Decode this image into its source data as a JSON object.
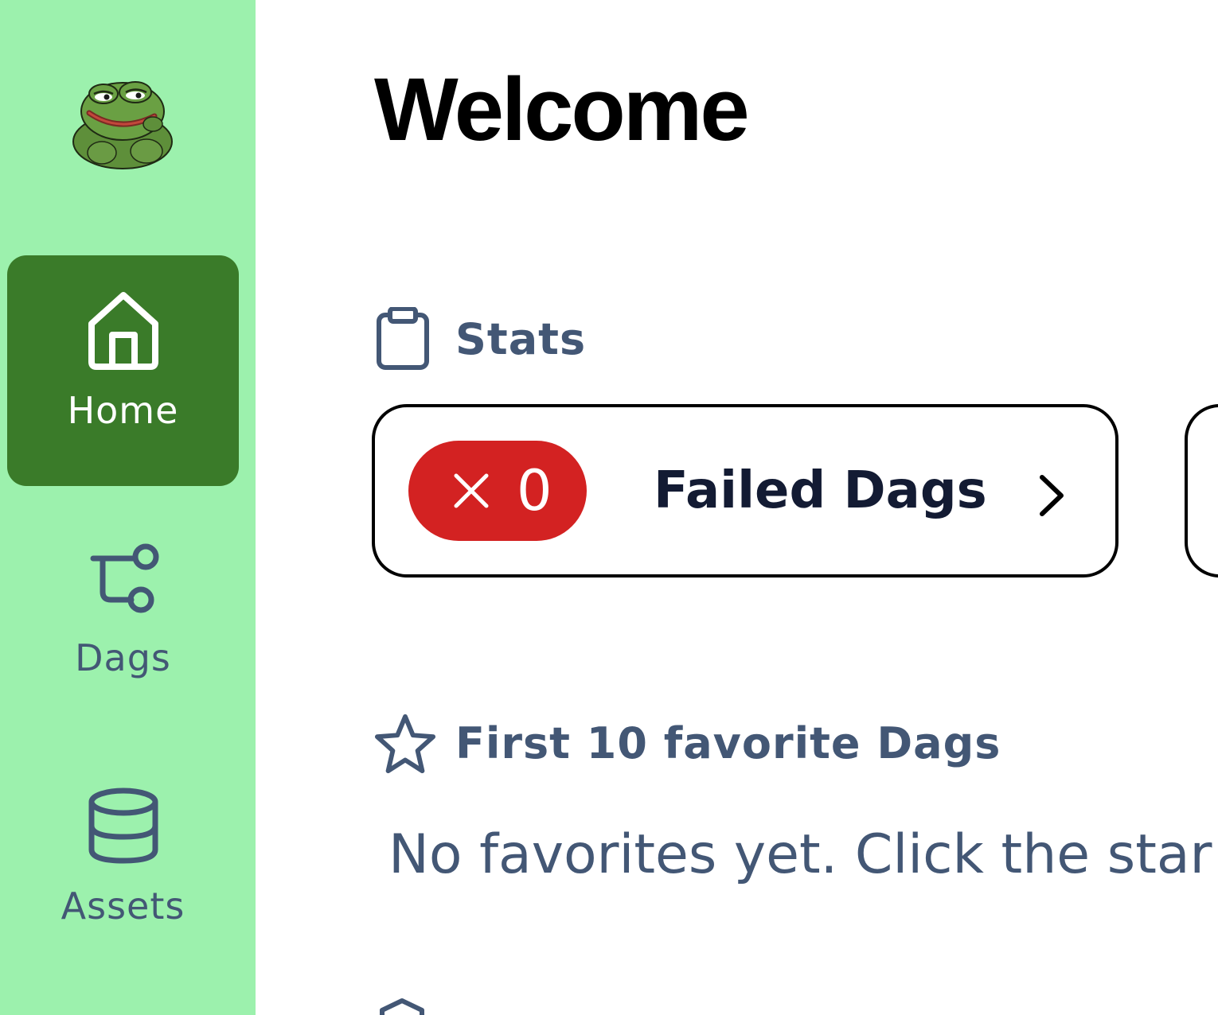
{
  "sidebar": {
    "logo": "frog-logo",
    "items": [
      {
        "label": "Home",
        "icon": "home-icon",
        "active": true
      },
      {
        "label": "Dags",
        "icon": "git-branch-icon",
        "active": false
      },
      {
        "label": "Assets",
        "icon": "database-icon",
        "active": false
      }
    ]
  },
  "main": {
    "title": "Welcome",
    "stats": {
      "heading": "Stats",
      "icon": "clipboard-icon",
      "cards": [
        {
          "count": "0",
          "label": "Failed Dags",
          "badge_color": "#d32222",
          "badge_icon": "x-icon",
          "chevron": "chevron-right-icon"
        }
      ]
    },
    "favorites": {
      "heading": "First 10 favorite Dags",
      "icon": "star-icon",
      "empty_text": "No favorites yet. Click the star i"
    },
    "health": {
      "icon": "shield-icon"
    }
  },
  "colors": {
    "sidebar_bg": "#9cf1ad",
    "active_nav": "#3a7b29",
    "muted_text": "#435775",
    "danger": "#d32222"
  }
}
